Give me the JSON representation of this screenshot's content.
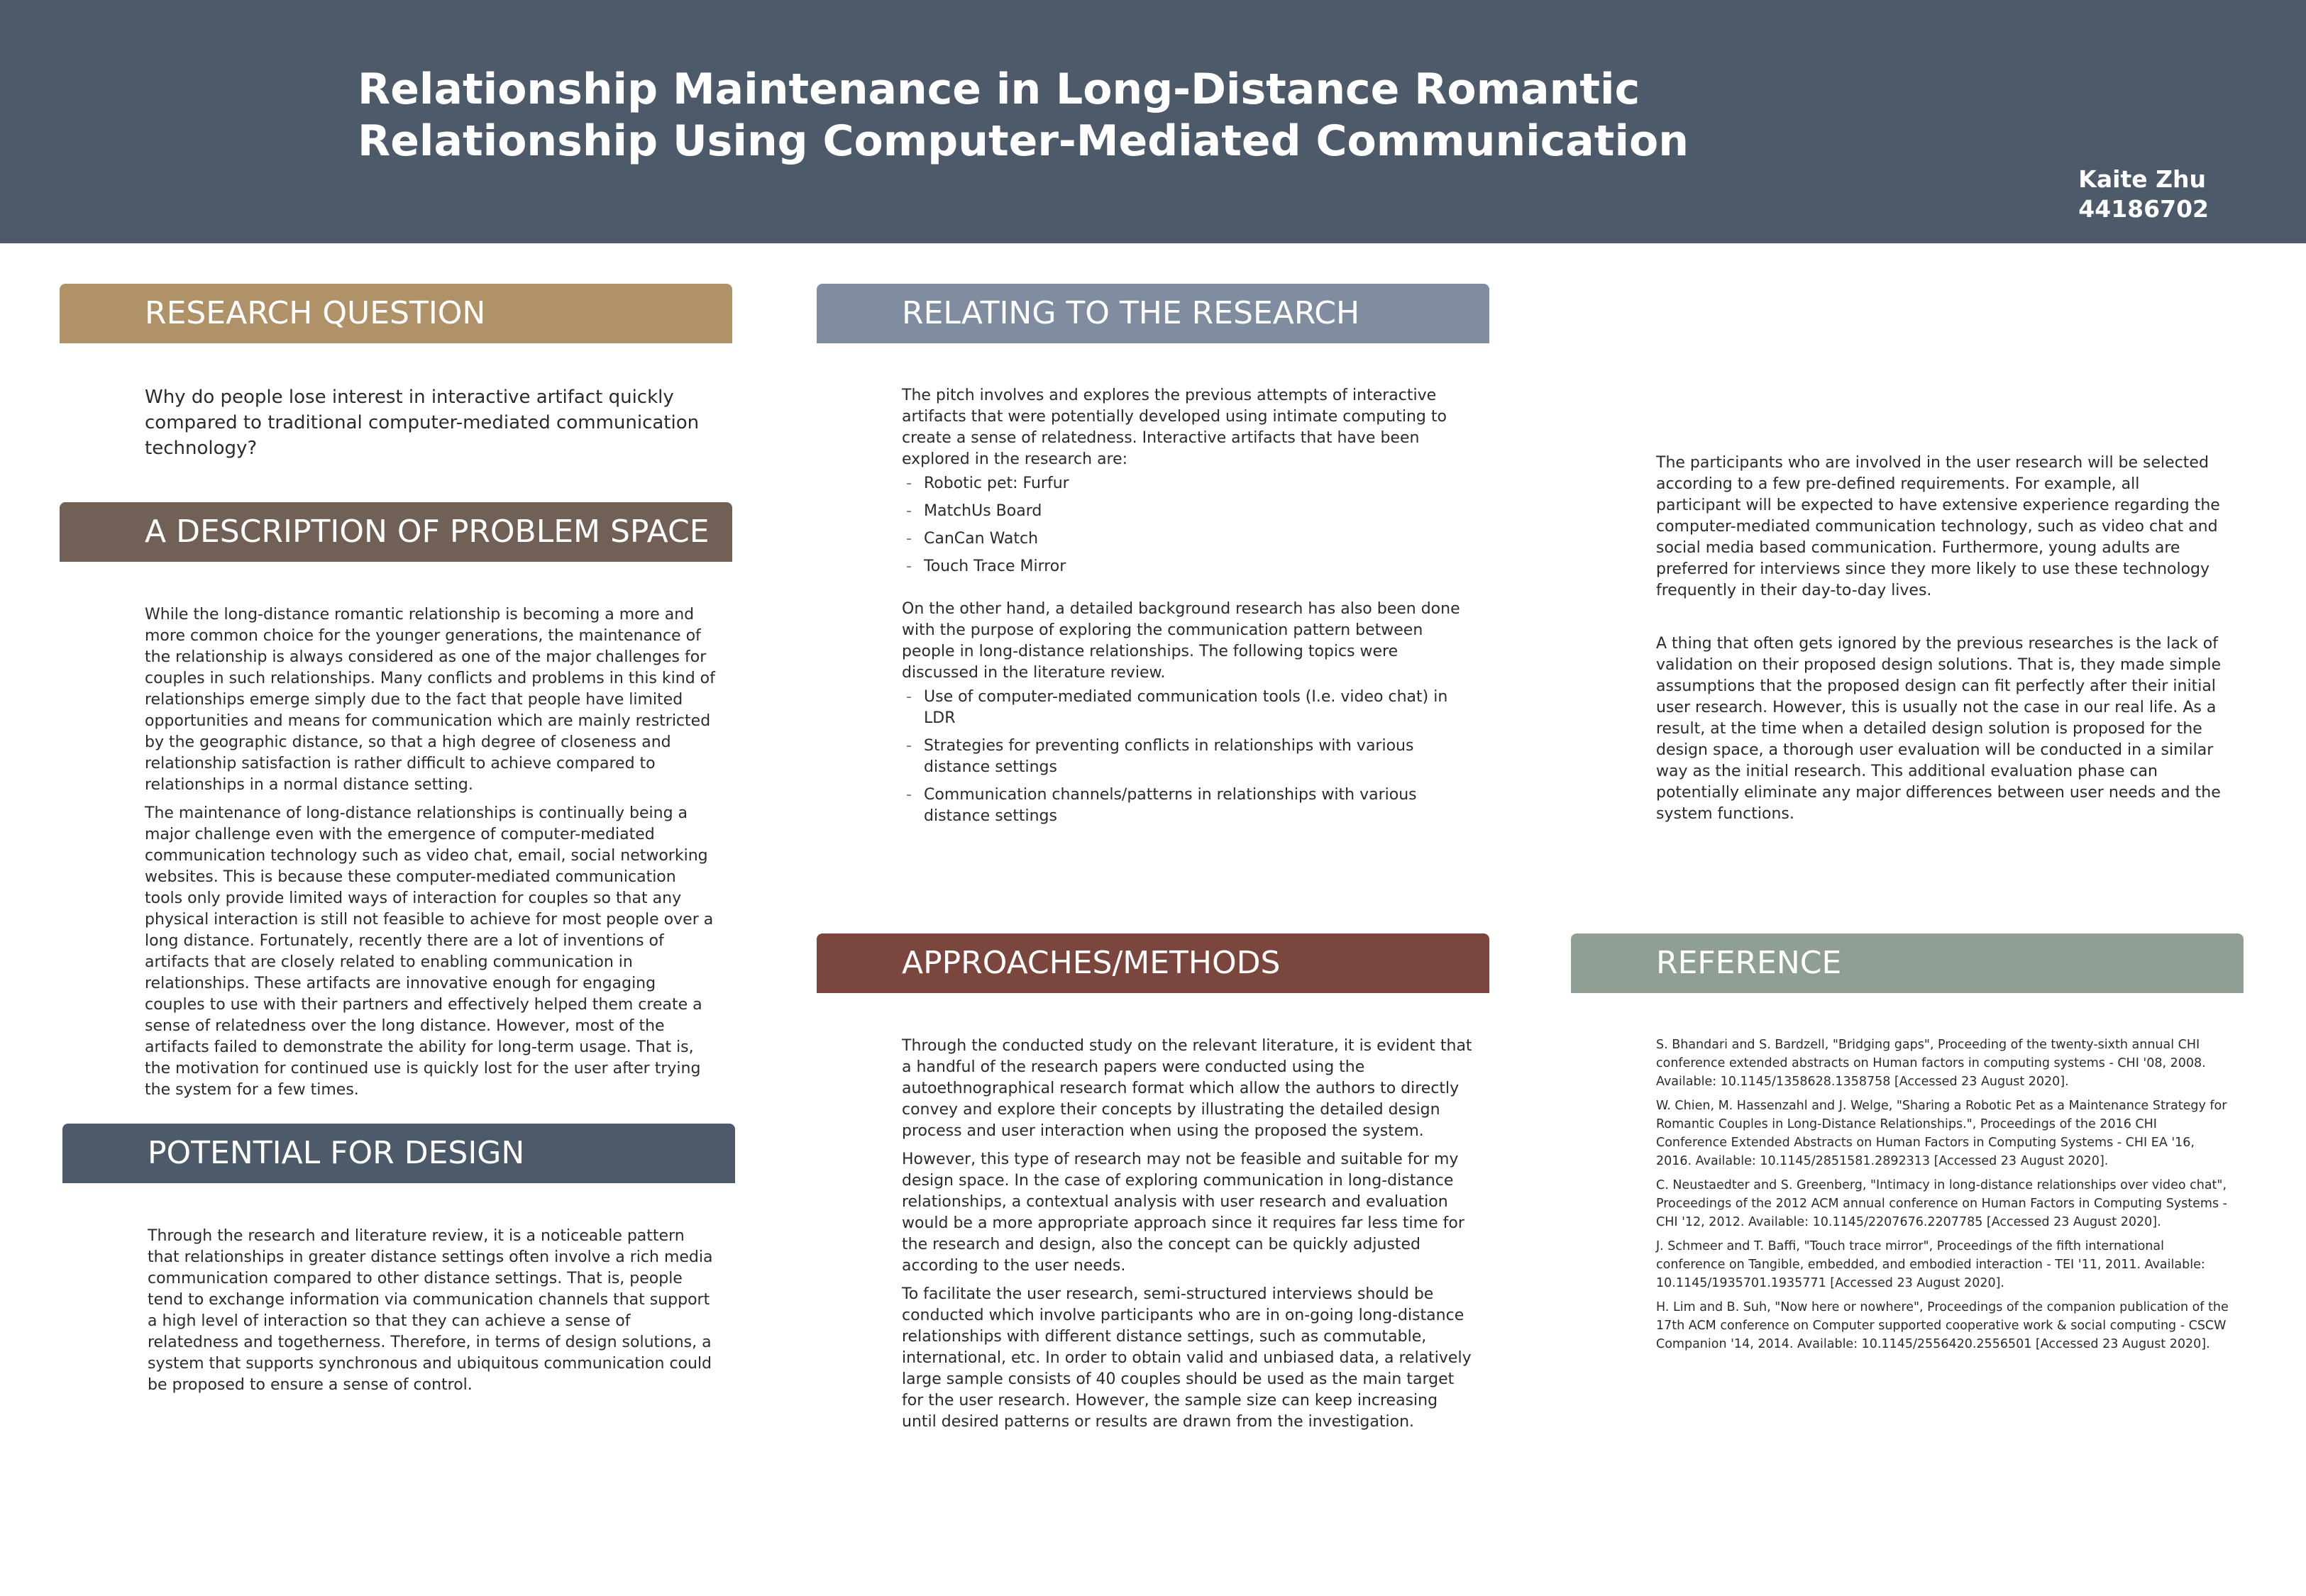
{
  "header": {
    "title": "Relationship Maintenance in Long-Distance Romantic Relationship Using Computer-Mediated Communication",
    "author_name": "Kaite Zhu",
    "author_id": "44186702"
  },
  "colors": {
    "header_bg": "#4d5a6a",
    "research_question": "#b09268",
    "problem_space": "#716055",
    "potential_design": "#4d5a6a",
    "relating_research": "#808ca0",
    "approaches": "#7b463e",
    "reference": "#909f93"
  },
  "research_question": {
    "heading": "RESEARCH QUESTION",
    "text": "Why do people lose interest in interactive artifact quickly compared to traditional computer-mediated communication technology?"
  },
  "problem_space": {
    "heading": "A DESCRIPTION OF PROBLEM SPACE",
    "p1": "While the long-distance romantic relationship is becoming a more and more common choice for the younger generations, the maintenance of the relationship is always considered as one of the major challenges for couples in such relationships. Many conflicts and problems in this kind of relationships emerge simply due to the fact that people have limited opportunities and means for communication which are mainly restricted by the geographic distance, so that a high degree of closeness and relationship satisfaction is rather difficult to achieve compared to relationships in a normal distance setting.",
    "p2": "The maintenance of long-distance relationships is continually being a major challenge even with the emergence of computer-mediated communication technology such as video chat, email, social networking websites. This is because these computer-mediated communication tools only provide limited ways of interaction for couples so that any physical interaction is still not feasible to achieve for most people over a long distance. Fortunately, recently there are a lot of inventions of artifacts that are closely related to enabling communication in relationships. These artifacts are innovative enough for engaging couples to use with their partners and effectively helped them create a sense of relatedness over the long distance. However, most of the artifacts failed to demonstrate the ability for long-term usage. That is, the motivation for continued use is quickly lost for the user after trying the system for a few times."
  },
  "potential_design": {
    "heading": "POTENTIAL FOR DESIGN",
    "text": "Through the research and literature review, it is a noticeable pattern that relationships in greater distance settings often involve a rich media communication compared to other distance settings. That is, people tend to exchange information via communication channels that support a high level of interaction so that they can achieve a sense of relatedness and togetherness. Therefore, in terms of design solutions, a system that supports synchronous and ubiquitous communication could be proposed to ensure a sense of control."
  },
  "relating_research": {
    "heading": "RELATING TO THE RESEARCH",
    "intro": "The pitch involves and explores the previous attempts of interactive artifacts that were potentially developed using intimate computing to create a sense of relatedness. Interactive artifacts that have been explored in the research are:",
    "artifacts": [
      "Robotic pet: Furfur",
      "MatchUs Board",
      "CanCan Watch",
      "Touch Trace Mirror"
    ],
    "p2": "On the other hand, a detailed background research has also been done with the purpose of exploring the communication pattern between people in long-distance relationships. The following topics were discussed in the literature review.",
    "topics": [
      "Use of computer-mediated communication tools (I.e. video chat) in LDR",
      "Strategies for preventing conflicts in relationships with various distance settings",
      "Communication channels/patterns in relationships with various distance settings"
    ]
  },
  "approaches": {
    "heading": "APPROACHES/METHODS",
    "p1": "Through the conducted study on the relevant literature, it is evident that a handful of the research papers were conducted using the autoethnographical research format which allow the authors to directly convey and explore their concepts by illustrating the detailed design process and user interaction when using the proposed the system.",
    "p2": "However, this type of research may not be feasible and suitable for my design space. In the case of exploring communication in long-distance relationships, a contextual analysis with user research and evaluation would be a more appropriate approach since it requires far less time for the research and design, also the concept can be quickly adjusted according to the user needs.",
    "p3": "To facilitate the user research, semi-structured interviews should be conducted which involve participants who are in on-going long-distance relationships with different distance settings, such as commutable, international, etc. In order to obtain valid and unbiased data, a relatively large sample consists of 40 couples should be used as the main target for the user research. However, the sample size can keep increasing until desired patterns or results are drawn from the investigation."
  },
  "right_column": {
    "p1": "The participants who are involved in the user research will be selected according to a few pre-defined requirements. For example, all participant will be expected to have extensive experience regarding the computer-mediated communication technology, such as video chat and social media based communication. Furthermore, young adults are preferred for interviews since they more likely to use these technology frequently in their day-to-day lives.",
    "p2": "A thing that often gets ignored by the previous researches is the lack of validation on their proposed design solutions. That is, they made simple assumptions that the proposed design can fit perfectly after their initial user research. However, this is usually not the case in our real life. As a result, at the time when a detailed design solution is proposed for the design space, a thorough user evaluation will be conducted in a similar way as the initial research. This additional evaluation phase can potentially eliminate any major differences between user needs and the system functions."
  },
  "reference": {
    "heading": "REFERENCE",
    "items": [
      "S. Bhandari and S. Bardzell, \"Bridging gaps\", Proceeding of the twenty-sixth annual CHI conference extended abstracts on Human factors in computing systems - CHI '08, 2008. Available: 10.1145/1358628.1358758 [Accessed 23 August 2020].",
      "W. Chien, M. Hassenzahl and J. Welge, \"Sharing a Robotic Pet as a Maintenance Strategy for Romantic Couples in Long-Distance Relationships.\", Proceedings of the 2016 CHI Conference Extended Abstracts on Human Factors in Computing Systems - CHI EA '16, 2016. Available: 10.1145/2851581.2892313 [Accessed 23 August 2020].",
      "C. Neustaedter and S. Greenberg, \"Intimacy in long-distance relationships over video chat\", Proceedings of the 2012 ACM annual conference on Human Factors in Computing Systems - CHI '12, 2012. Available: 10.1145/2207676.2207785 [Accessed 23 August 2020].",
      "J. Schmeer and T. Baffi, \"Touch trace mirror\", Proceedings of the fifth international conference on Tangible, embedded, and embodied interaction - TEI '11, 2011. Available: 10.1145/1935701.1935771 [Accessed 23 August 2020].",
      "H. Lim and B. Suh, \"Now here or nowhere\", Proceedings of the companion publication of the 17th ACM conference on Computer supported cooperative work & social computing - CSCW Companion '14, 2014. Available: 10.1145/2556420.2556501 [Accessed 23 August 2020]."
    ]
  }
}
